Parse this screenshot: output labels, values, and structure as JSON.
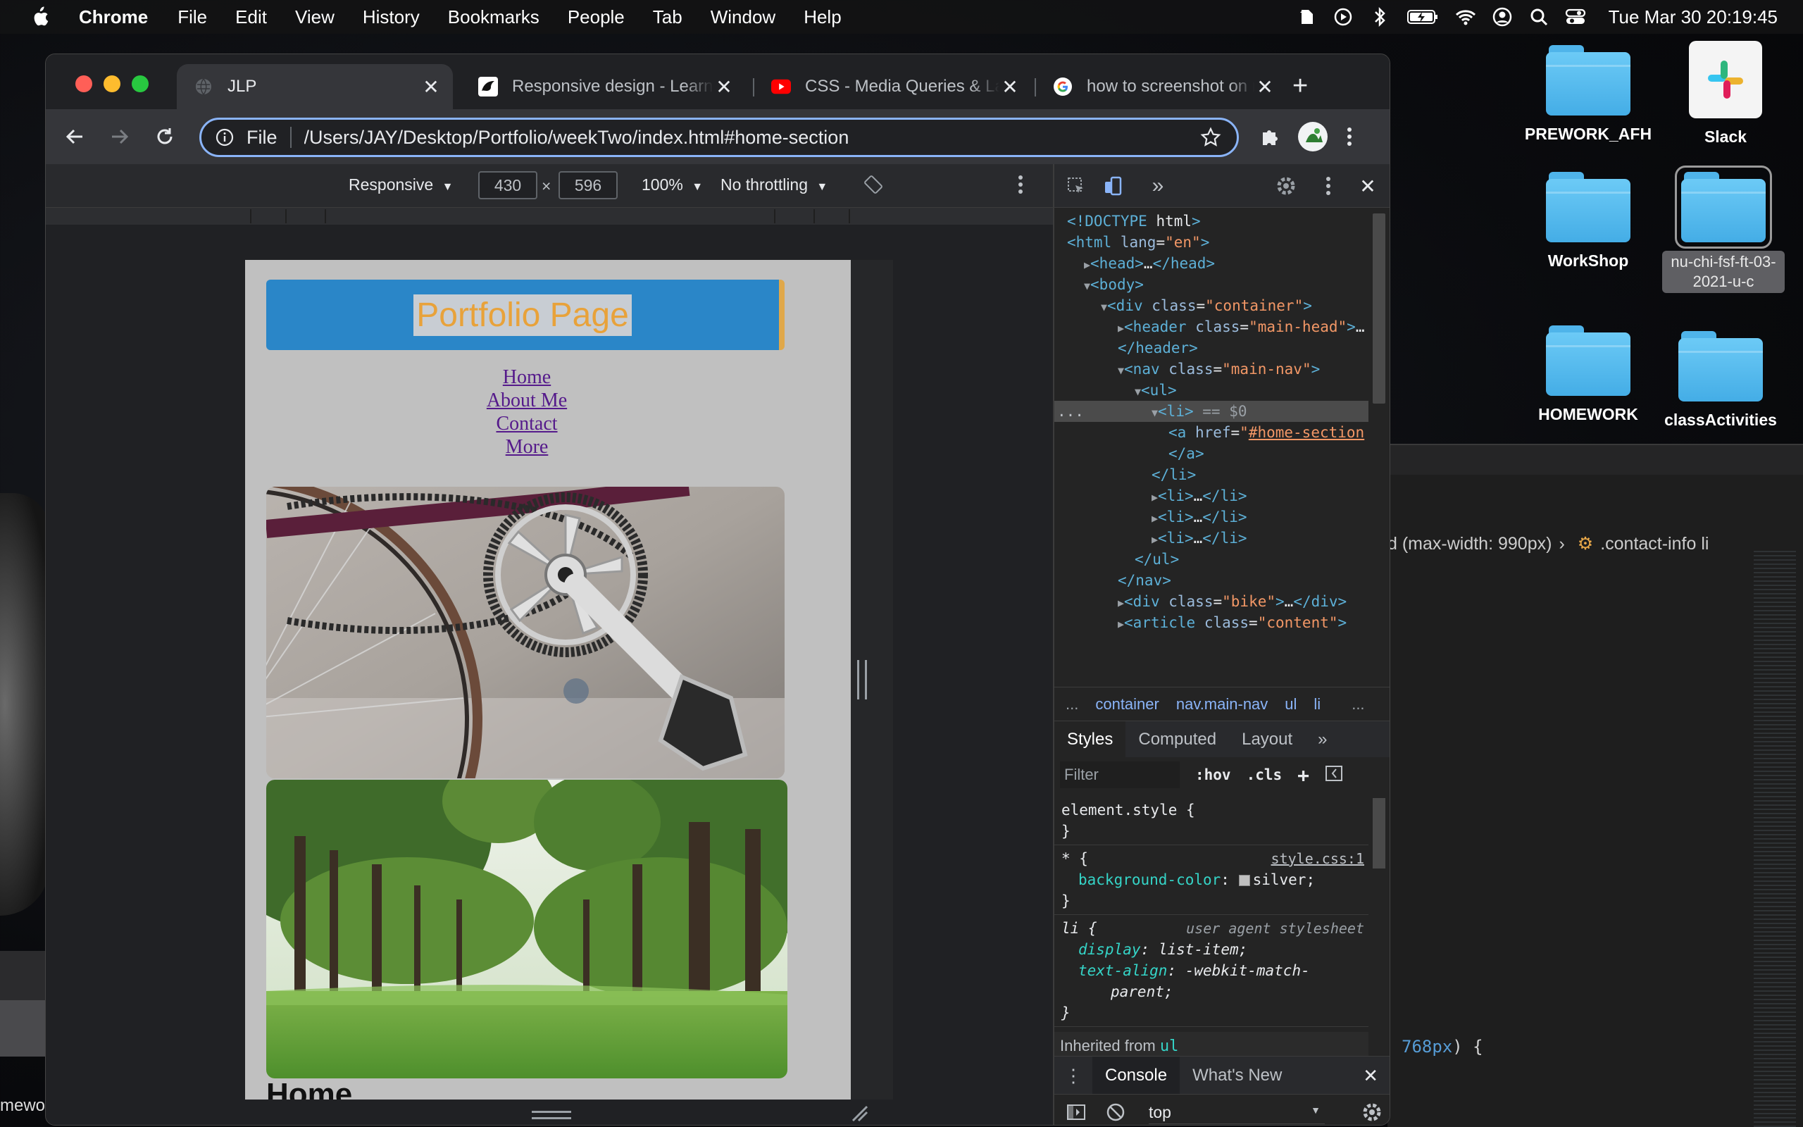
{
  "menubar": {
    "app_name": "Chrome",
    "items": [
      "File",
      "Edit",
      "View",
      "History",
      "Bookmarks",
      "People",
      "Tab",
      "Window",
      "Help"
    ],
    "clock": "Tue Mar 30  20:19:45",
    "status_icons": [
      "evernote-icon",
      "play-icon",
      "bluetooth-icon",
      "battery-icon",
      "wifi-icon",
      "user-icon",
      "search-icon",
      "control-center-icon"
    ]
  },
  "desktop": {
    "icons": [
      {
        "label": "PREWORK_AFH",
        "type": "folder"
      },
      {
        "label": "Slack",
        "type": "app"
      },
      {
        "label": "WorkShop",
        "type": "folder"
      },
      {
        "label": "nu-chi-fsf-ft-03-2021-u-c",
        "type": "folder"
      },
      {
        "label": "HOMEWORK",
        "type": "folder"
      },
      {
        "label": "classActivities",
        "type": "folder"
      }
    ],
    "left_label": "mewo"
  },
  "editor_bg": {
    "breadcrumb_left": "d (max-width: 990px)",
    "breadcrumb_right": ".contact-info li",
    "code_num": "768",
    "code_rest": "px) {"
  },
  "chrome": {
    "tabs": [
      {
        "title": "JLP",
        "active": true
      },
      {
        "title": "Responsive design - Learn web development",
        "active": false
      },
      {
        "title": "CSS - Media Queries & Layouts",
        "active": false
      },
      {
        "title": "how to screenshot on mac",
        "active": false
      }
    ],
    "omnibox": {
      "scheme": "File",
      "url": "/Users/JAY/Desktop/Portfolio/weekTwo/index.html#home-section"
    }
  },
  "devicebar": {
    "device": "Responsive",
    "width": "430",
    "height": "596",
    "times": "×",
    "zoom": "100%",
    "throttle": "No throttling"
  },
  "site": {
    "title": "Portfolio Page",
    "nav": [
      "Home",
      "About Me",
      "Contact",
      "More"
    ],
    "heading": "Home"
  },
  "devtools": {
    "elements": [
      {
        "indent": 0,
        "html": "<!DOCTYPE html>"
      },
      {
        "indent": 0,
        "html": "<html lang=\"en\">"
      },
      {
        "indent": 1,
        "html": "▶<head>…</head>"
      },
      {
        "indent": 1,
        "html": "▼<body>"
      },
      {
        "indent": 2,
        "html": "▼<div class=\"container\">"
      },
      {
        "indent": 3,
        "html": "▶<header class=\"main-head\">…"
      },
      {
        "indent": 3,
        "html": "</header>"
      },
      {
        "indent": 3,
        "html": "▼<nav class=\"main-nav\">"
      },
      {
        "indent": 4,
        "html": "▼<ul>"
      },
      {
        "indent": 5,
        "html": "▼<li> == $0"
      },
      {
        "indent": 6,
        "html": "<a href=\"#home-section"
      },
      {
        "indent": 6,
        "html": "</a>"
      },
      {
        "indent": 5,
        "html": "</li>"
      },
      {
        "indent": 5,
        "html": "▶<li>…</li>"
      },
      {
        "indent": 5,
        "html": "▶<li>…</li>"
      },
      {
        "indent": 5,
        "html": "▶<li>…</li>"
      },
      {
        "indent": 4,
        "html": "</ul>"
      },
      {
        "indent": 3,
        "html": "</nav>"
      },
      {
        "indent": 3,
        "html": "▶<div class=\"bike\">…</div>"
      },
      {
        "indent": 3,
        "html": "▶<article class=\"content\">"
      }
    ],
    "selected_dots": "...",
    "breadcrumb": [
      "container",
      "nav.main-nav",
      "ul",
      "li"
    ],
    "crumb_more": "...",
    "styles_tabs": [
      "Styles",
      "Computed",
      "Layout"
    ],
    "more_tabs": "»",
    "filter_placeholder": "Filter",
    "filter_hov": ":hov",
    "filter_cls": ".cls",
    "rules": {
      "element_style": "element.style {",
      "close": "}",
      "star_selector": "* {",
      "star_source": "style.css:1",
      "star_prop": "background-color",
      "star_value": "silver;",
      "li_selector": "li {",
      "li_source": "user agent stylesheet",
      "li_prop1": "display",
      "li_val1": "list-item;",
      "li_prop2": "text-align",
      "li_val2": "-webkit-match-",
      "li_val2b": "parent;"
    },
    "inherited_label": "Inherited from",
    "inherited_tag": "ul",
    "drawer_tabs": [
      "Console",
      "What's New"
    ],
    "console_context": "top",
    "console_prompt": "›"
  }
}
